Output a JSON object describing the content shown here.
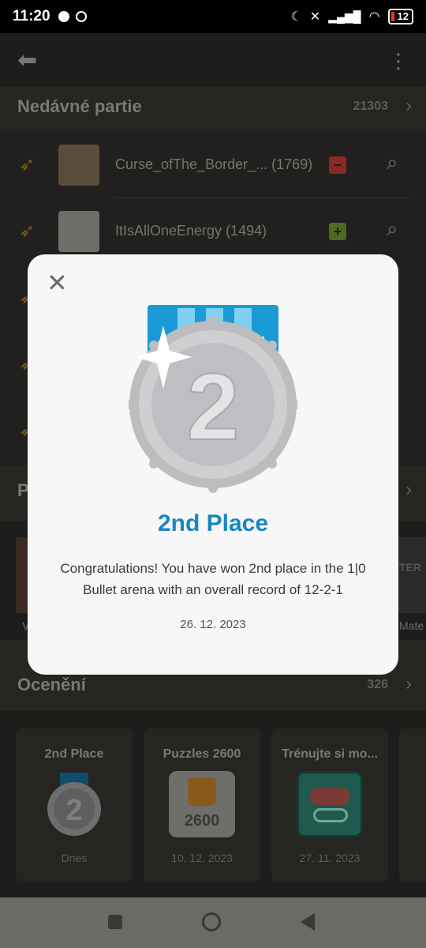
{
  "status_bar": {
    "time": "11:20",
    "battery": "12"
  },
  "recent_games": {
    "title": "Nedávné partie",
    "count": "21303",
    "rows": [
      {
        "name": "Curse_ofThe_Border_... (1769)",
        "result": "loss"
      },
      {
        "name": "ItIsAllOneEnergy (1494)",
        "result": "win"
      },
      {
        "name": "",
        "result": ""
      },
      {
        "name": "",
        "result": ""
      },
      {
        "name": "",
        "result": ""
      }
    ]
  },
  "videos_section": {
    "title": "P",
    "item_labels": [
      "V",
      "Mate"
    ],
    "thumb_text": "TER"
  },
  "awards": {
    "title": "Ocenění",
    "count": "326",
    "cards": [
      {
        "title": "2nd Place",
        "date": "Dnes"
      },
      {
        "title": "Puzzles 2600",
        "date": "10. 12. 2023",
        "badge_text": "2600"
      },
      {
        "title": "Trénujte si mo...",
        "date": "27. 11. 2023"
      }
    ]
  },
  "modal": {
    "medal_number": "2",
    "title": "2nd Place",
    "body": "Congratulations! You have won 2nd place in the 1|0 Bullet arena with an overall record of 12-2-1",
    "date": "26. 12. 2023"
  },
  "colors": {
    "accent": "#1a85c6",
    "medal_silver": "#c9c9cc",
    "ribbon": "#1a9ad6"
  }
}
